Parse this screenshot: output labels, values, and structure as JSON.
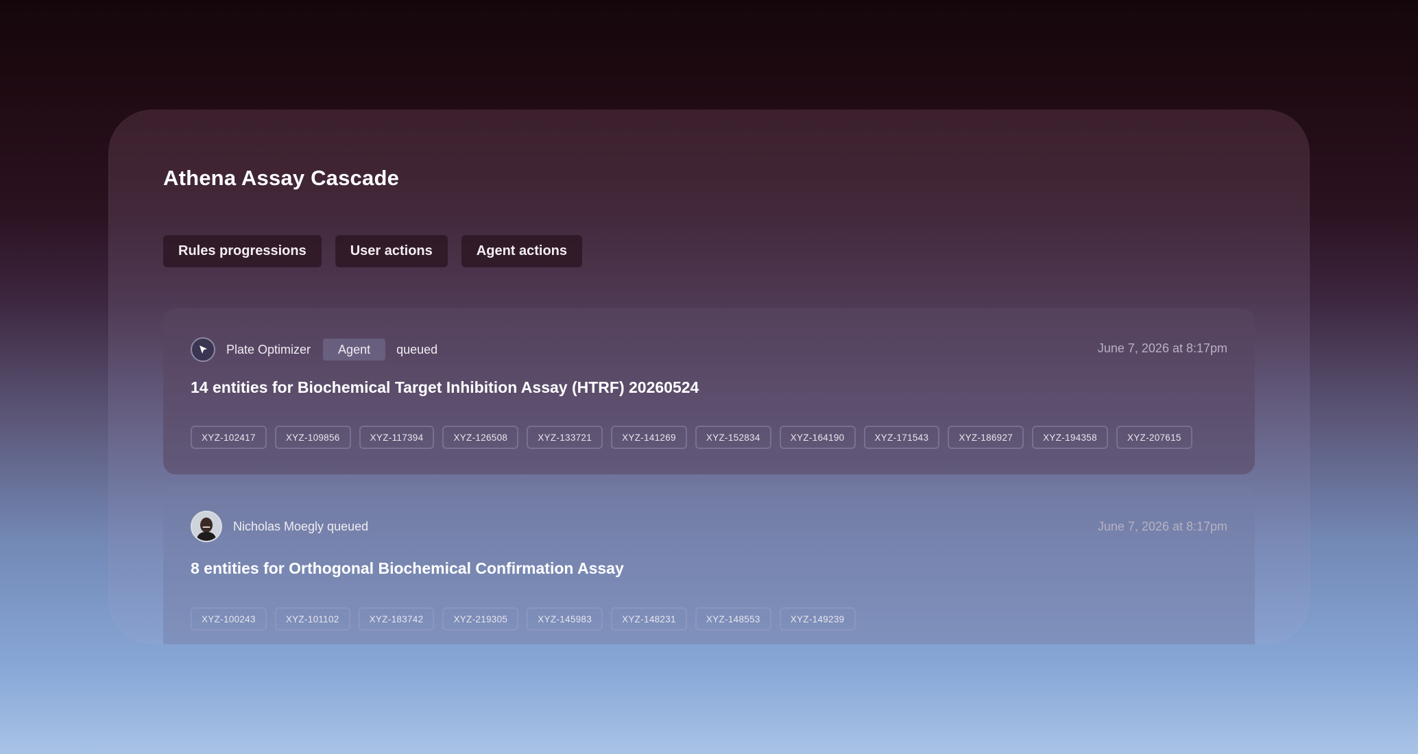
{
  "page": {
    "title": "Athena Assay Cascade"
  },
  "tabs": [
    {
      "label": "Rules progressions"
    },
    {
      "label": "User actions"
    },
    {
      "label": "Agent actions"
    }
  ],
  "events": [
    {
      "actor": "Plate Optimizer",
      "badge": "Agent",
      "verb": "queued",
      "timestamp": "June 7, 2026 at 8:17pm",
      "heading": "14 entities for Biochemical Target Inhibition Assay (HTRF) 20260524",
      "entities": [
        "XYZ-102417",
        "XYZ-109856",
        "XYZ-117394",
        "XYZ-126508",
        "XYZ-133721",
        "XYZ-141269",
        "XYZ-152834",
        "XYZ-164190",
        "XYZ-171543",
        "XYZ-186927",
        "XYZ-194358",
        "XYZ-207615"
      ]
    },
    {
      "actor": "Nicholas Moegly queued",
      "timestamp": "June 7, 2026 at 8:17pm",
      "heading": "8 entities for Orthogonal Biochemical Confirmation Assay",
      "entities": [
        "XYZ-100243",
        "XYZ-101102",
        "XYZ-183742",
        "XYZ-219305",
        "XYZ-145983",
        "XYZ-148231",
        "XYZ-148553",
        "XYZ-149239"
      ]
    }
  ],
  "icons": {
    "agent": "cursor-arrow-icon",
    "user": "user-avatar"
  }
}
